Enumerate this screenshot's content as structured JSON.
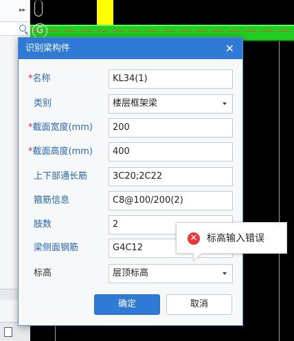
{
  "background": {
    "axis_label": "G"
  },
  "dialog": {
    "title": "识别梁构件",
    "fields": [
      {
        "label": "名称",
        "required": true,
        "value": "KL34(1)",
        "type": "text"
      },
      {
        "label": "类别",
        "required": false,
        "value": "楼层框架梁",
        "type": "select"
      },
      {
        "label": "截面宽度(mm)",
        "required": true,
        "value": "200",
        "type": "text"
      },
      {
        "label": "截面高度(mm)",
        "required": true,
        "value": "400",
        "type": "text"
      },
      {
        "label": "上下部通长筋",
        "required": false,
        "value": "3C20;2C22",
        "type": "text"
      },
      {
        "label": "箍筋信息",
        "required": false,
        "value": "C8@100/200(2)",
        "type": "text"
      },
      {
        "label": "肢数",
        "required": false,
        "value": "2",
        "type": "text"
      },
      {
        "label": "梁侧面钢筋",
        "required": false,
        "value": "G4C12",
        "type": "text"
      },
      {
        "label": "标高",
        "required": false,
        "value": "层顶标高",
        "type": "select"
      }
    ],
    "required_mark": "*",
    "ok_label": "确定",
    "cancel_label": "取消"
  },
  "tooltip": {
    "message": "标高输入错误"
  },
  "colors": {
    "accent": "#2f7ad6",
    "error": "#e8383c",
    "required": "#e0262a",
    "label": "#2666b7"
  }
}
